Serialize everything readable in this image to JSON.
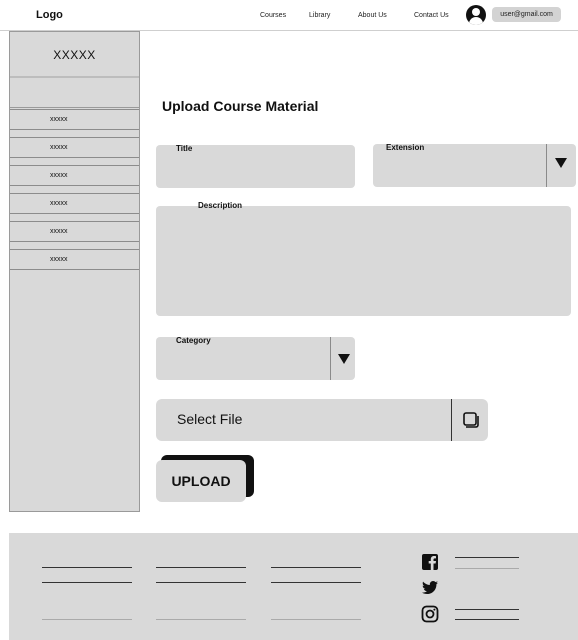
{
  "header": {
    "logo": "Logo",
    "nav": [
      "Courses",
      "Library",
      "About Us",
      "Contact Us"
    ],
    "user_email": "user@gmail.com"
  },
  "sidebar": {
    "title": "XXXXX",
    "items": [
      "xxxxx",
      "xxxxx",
      "xxxxx",
      "xxxxx",
      "xxxxx",
      "xxxxx"
    ]
  },
  "main": {
    "page_title": "Upload Course Material",
    "title_label": "Title",
    "extension_label": "Extension",
    "description_label": "Description",
    "category_label": "Category",
    "select_file_label": "Select File",
    "upload_label": "UPLOAD"
  },
  "footer": {
    "social": [
      "facebook-icon",
      "twitter-icon",
      "instagram-icon"
    ]
  },
  "colors": {
    "panel": "#d9d9d9",
    "text": "#111111"
  }
}
